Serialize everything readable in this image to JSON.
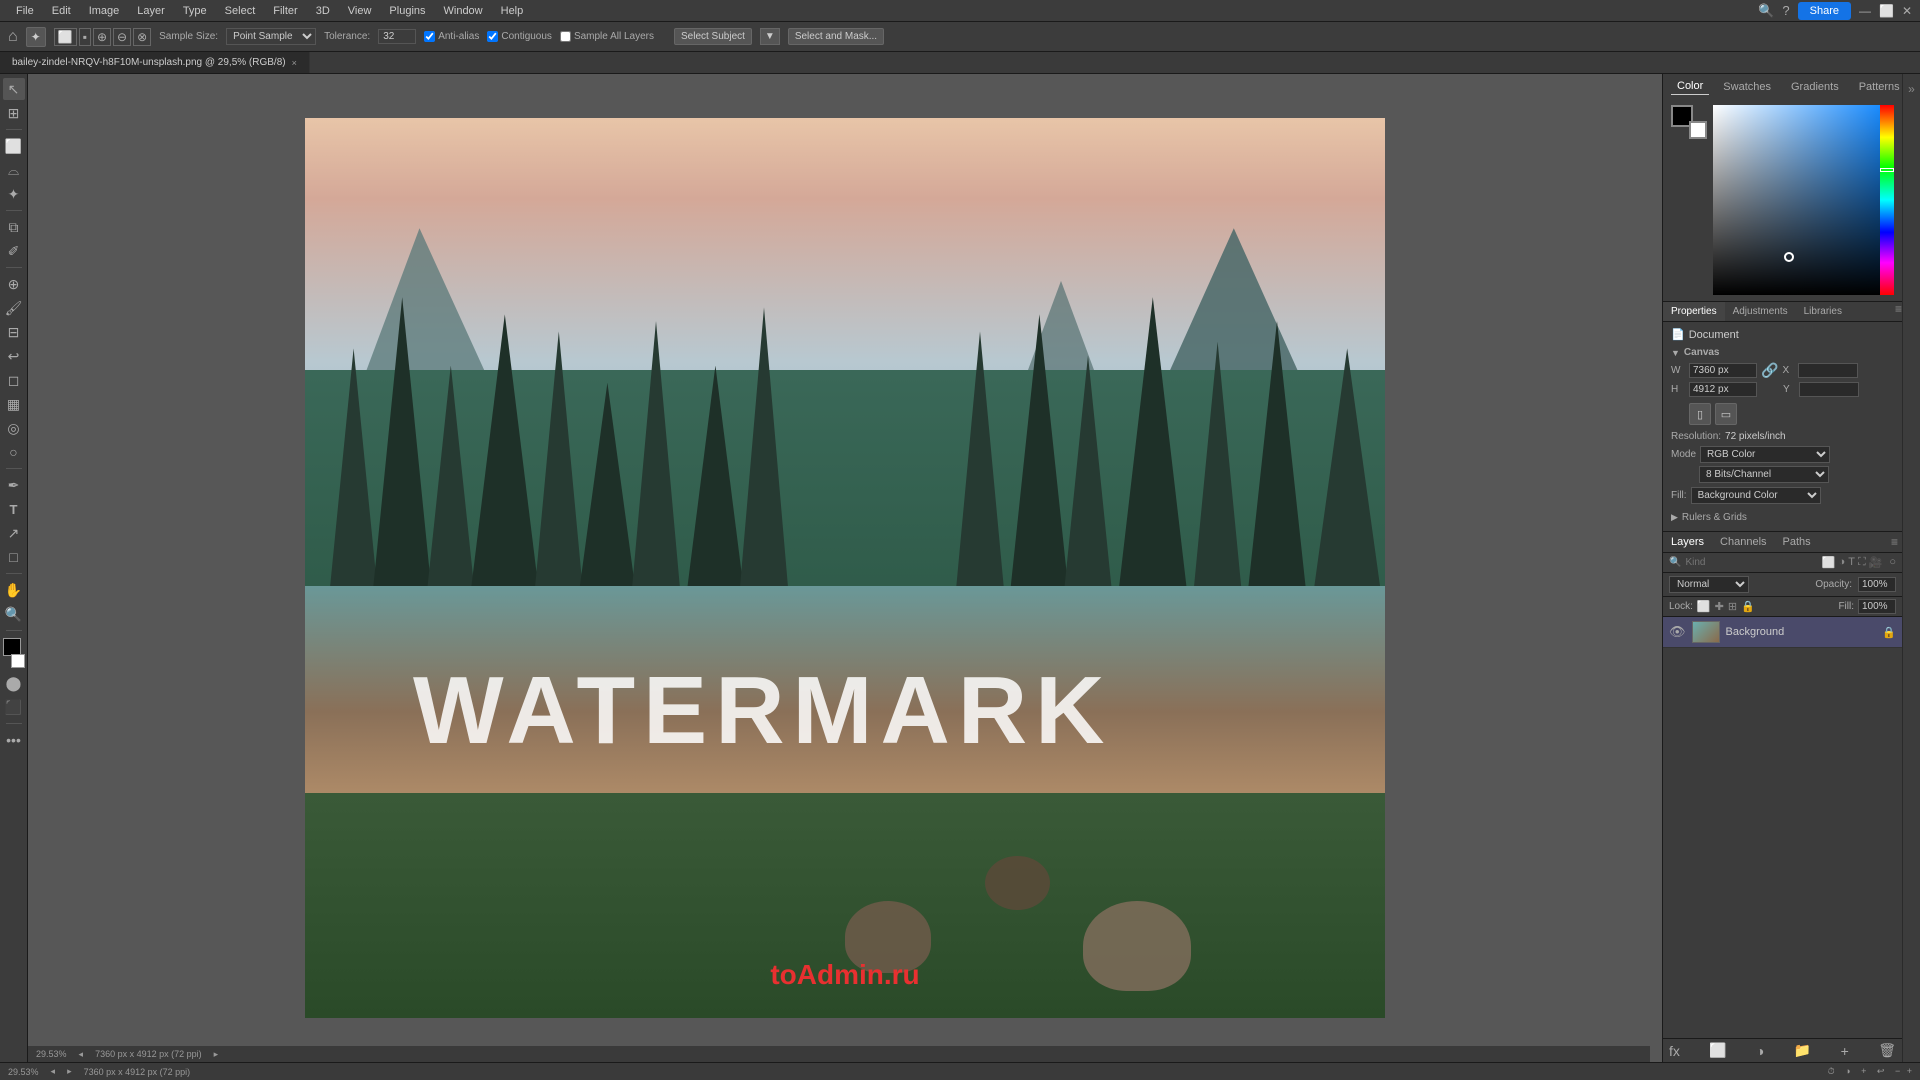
{
  "app": {
    "title": "Adobe Photoshop"
  },
  "menu": {
    "items": [
      "File",
      "Edit",
      "Image",
      "Layer",
      "Type",
      "Select",
      "Filter",
      "3D",
      "View",
      "Plugins",
      "Window",
      "Help"
    ]
  },
  "options_bar": {
    "tool_icon": "⊙",
    "sample_size_label": "Sample Size:",
    "sample_size_value": "Point Sample",
    "tolerance_label": "Tolerance:",
    "tolerance_value": "32",
    "anti_alias_label": "Anti-alias",
    "contiguous_label": "Contiguous",
    "sample_all_label": "Sample All Layers",
    "select_subject_btn": "Select Subject",
    "select_mask_btn": "Select and Mask...",
    "share_btn": "Share"
  },
  "tab": {
    "filename": "bailey-zindel-NRQV-h8F10M-unsplash.png @ 29,5% (RGB/8)",
    "close": "×"
  },
  "canvas": {
    "zoom": "29.53%",
    "dimensions": "7360 px x 4912 px (72 ppi)",
    "watermark": "WATERMARK",
    "watermark_admin": "toAdmin.ru"
  },
  "tools": {
    "items": [
      "↖",
      "✥",
      "⊕",
      "⊘",
      "✂",
      "⬜",
      "⬡",
      "✒",
      "🖊",
      "🔍",
      "T",
      "□",
      "⬛",
      "✋",
      "🔍",
      "…"
    ]
  },
  "color_panel": {
    "tabs": [
      "Color",
      "Swatches",
      "Gradients",
      "Patterns"
    ],
    "active_tab": "Color",
    "foreground": "#000000",
    "background": "#ffffff"
  },
  "properties_panel": {
    "tabs": [
      "Properties",
      "Adjustments",
      "Libraries"
    ],
    "active_tab": "Properties",
    "document_label": "Document",
    "canvas_section": "Canvas",
    "w_label": "W",
    "w_value": "7360 px",
    "h_label": "H",
    "h_value": "4912 px",
    "x_label": "X",
    "x_value": "",
    "y_label": "Y",
    "y_value": "",
    "resolution_label": "Resolution:",
    "resolution_value": "72 pixels/inch",
    "mode_label": "Mode",
    "mode_value": "RGB Color",
    "depth_value": "8 Bits/Channel",
    "fill_label": "Fill:",
    "fill_value": "Background Color",
    "rulers_grids": "Rulers & Grids"
  },
  "layers_panel": {
    "tabs": [
      "Layers",
      "Channels",
      "Paths"
    ],
    "active_tab": "Layers",
    "search_placeholder": "Kind",
    "blend_mode": "Normal",
    "opacity_label": "Opacity:",
    "opacity_value": "100%",
    "lock_label": "Lock:",
    "fill_label": "Fill:",
    "fill_value": "100%",
    "layers": [
      {
        "name": "Background",
        "visible": true,
        "locked": true,
        "thumb_color_a": "#6aafaf",
        "thumb_color_b": "#8a6a4a"
      }
    ]
  },
  "status_bar": {
    "zoom": "29.53%",
    "dimensions": "7360 px x 4912 px (72 ppi)"
  }
}
